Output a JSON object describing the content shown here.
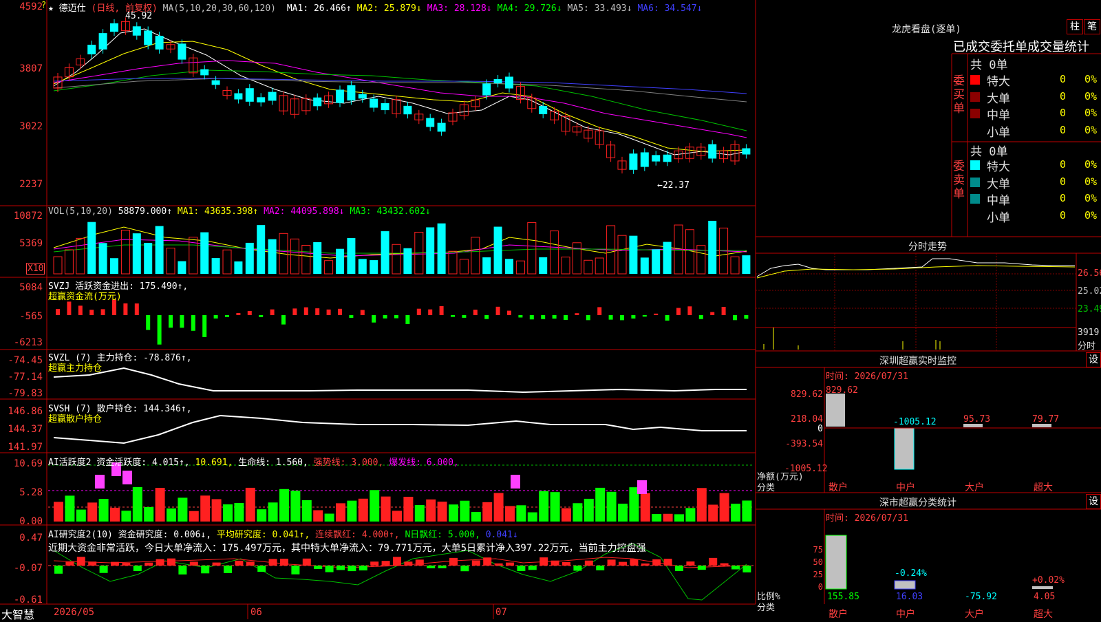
{
  "stock": {
    "star": "★",
    "name": "德迈仕",
    "period": "(日线, 前复权)",
    "ma_label": "MA(5,10,20,30,60,120)",
    "ma": [
      {
        "label": "MA1: 26.466↑",
        "color": "#ffffff"
      },
      {
        "label": "MA2: 25.879↓",
        "color": "#ffff00"
      },
      {
        "label": "MA3: 28.128↓",
        "color": "#ff00ff"
      },
      {
        "label": "MA4: 29.726↓",
        "color": "#00ff00"
      },
      {
        "label": "MA5: 33.493↓",
        "color": "#c0c0c0"
      },
      {
        "label": "MA6: 34.547↓",
        "color": "#4040ff"
      }
    ],
    "high": "45.92",
    "low": "←22.37",
    "axis": [
      "45927",
      "3807",
      "3022",
      "2237"
    ],
    "axis_top": "4592",
    "q_mark": "?"
  },
  "vol": {
    "title": "VOL(5,10,20)",
    "v": "58879.000↑",
    "ma1": "MA1: 43635.398↑",
    "ma2": "MA2: 44095.898↓",
    "ma3": "MA3: 43432.602↓",
    "axis": [
      "10872",
      "5369"
    ],
    "unit": "X10"
  },
  "svzj": {
    "title": "SVZJ  活跃资金进出: 175.490↑,",
    "sub": "超赢资金流(万元)",
    "axis": [
      "5084",
      "-565",
      "-6213"
    ]
  },
  "svzl": {
    "title": "SVZL (7) 主力持仓: -78.876↑,",
    "sub": "超赢主力持仓",
    "axis": [
      "-74.45",
      "-77.14",
      "-79.83"
    ]
  },
  "svsh": {
    "title": "SVSH (7) 散户持仓: 144.346↑,",
    "sub": "超赢散户持仓",
    "axis": [
      "146.86",
      "144.37",
      "141.97"
    ]
  },
  "ai1": {
    "title": "AI活跃度2 资金活跃度: 4.015↑,",
    "v2": "10.691,",
    "v3": "生命线: 1.560,",
    "v4": "强势线: 3.000,",
    "v5": "爆发线: 6.000,",
    "axis": [
      "10.69",
      "5.28",
      "0.00"
    ]
  },
  "ai2": {
    "title": "AI研究度2(10) 资金研究度: 0.006↓,",
    "v2": "平均研究度: 0.041↑,",
    "v3": "连续飘红: 4.000↑,",
    "v4": "N日飘红: 5.000,",
    "v5": "0.041↓",
    "axis": [
      "0.47",
      "-0.07",
      "-0.61"
    ],
    "note": "近期大资金非常活跃，今日大单净流入：175.497万元，其中特大单净流入：79.771万元，大单5日累计净入397.22万元，当前主力控盘强"
  },
  "bottom": {
    "brand": "大智慧",
    "dates": [
      "2026/05",
      "06",
      "07"
    ]
  },
  "lhb": {
    "title": "龙虎看盘(逐单)",
    "btn1": "柱",
    "btn2": "笔",
    "header": "已成交委托单成交量统计",
    "buy": {
      "label": "委买单",
      "total": "共 0单",
      "rows": [
        {
          "name": "特大",
          "n": "0",
          "p": "0%"
        },
        {
          "name": "大单",
          "n": "0",
          "p": "0%"
        },
        {
          "name": "中单",
          "n": "0",
          "p": "0%"
        },
        {
          "name": "小单",
          "n": "0",
          "p": "0%"
        }
      ]
    },
    "sell": {
      "label": "委卖单",
      "total": "共 0单",
      "rows": [
        {
          "name": "特大",
          "n": "0",
          "p": "0%"
        },
        {
          "name": "大单",
          "n": "0",
          "p": "0%"
        },
        {
          "name": "中单",
          "n": "0",
          "p": "0%"
        },
        {
          "name": "小单",
          "n": "0",
          "p": "0%"
        }
      ]
    }
  },
  "intraday": {
    "title": "分时走势",
    "axis": [
      "26.56",
      "25.02",
      "23.49"
    ],
    "vol": "3919",
    "vol_label": "分时"
  },
  "szmon": {
    "title": "深圳超赢实时监控",
    "btn": "设",
    "time": "时间: 2026/07/31",
    "axis": [
      "829.62",
      "218.04",
      "0",
      "-393.54",
      "-1005.12"
    ],
    "bars": [
      {
        "label": "829.62"
      },
      {
        "label": "-1005.12"
      },
      {
        "label": "95.73"
      },
      {
        "label": "79.77"
      }
    ],
    "ylabel": "净额(万元)",
    "xlabel": "分类",
    "cats": [
      "散户",
      "中户",
      "大户",
      "超大"
    ]
  },
  "szstat": {
    "title": "深市超赢分类统计",
    "btn": "设",
    "time": "时间: 2026/07/31",
    "axis": [
      "75",
      "50",
      "25",
      "0"
    ],
    "pct": [
      "-0.24%",
      "+0.02%"
    ],
    "values": [
      "155.85",
      "16.03",
      "-75.92",
      "4.05"
    ],
    "ylabel": "比例%",
    "xlabel": "分类",
    "cats": [
      "散户",
      "中户",
      "大户",
      "超大"
    ]
  },
  "colors": {
    "up": "#ff2020",
    "down": "#00ffff",
    "grid": "#c00000"
  }
}
